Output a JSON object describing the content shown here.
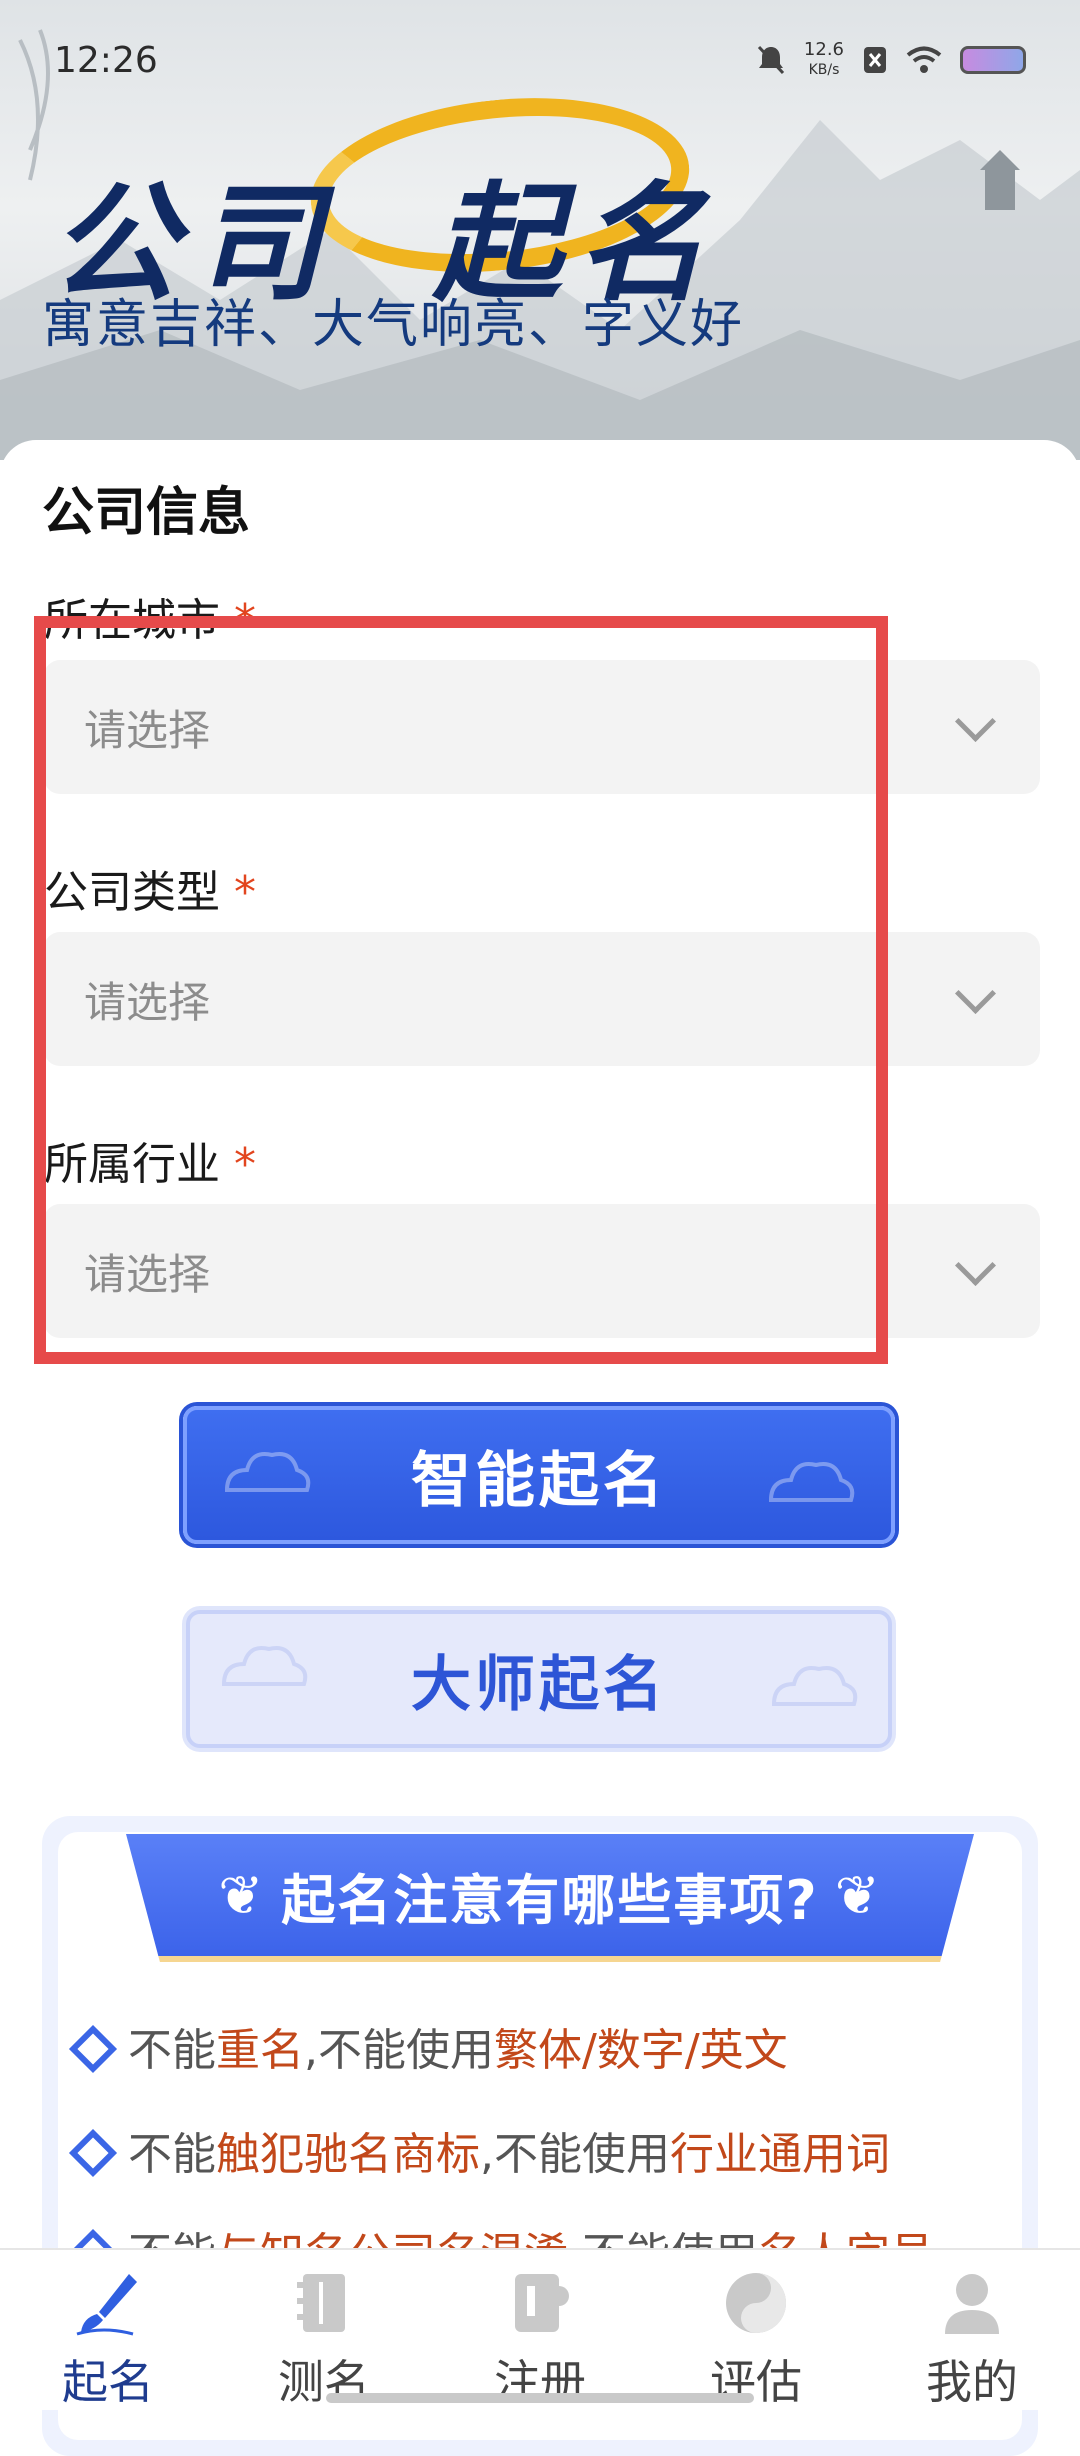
{
  "status_bar": {
    "time": "12:26",
    "net_speed_value": "12.6",
    "net_speed_unit": "KB/s"
  },
  "header": {
    "brand_left": "公司",
    "brand_right": "起名",
    "slogan": "寓意吉祥、大气响亮、字义好"
  },
  "form": {
    "section_title": "公司信息",
    "required_mark": "*",
    "fields": [
      {
        "label": "所在城市",
        "placeholder": "请选择"
      },
      {
        "label": "公司类型",
        "placeholder": "请选择"
      },
      {
        "label": "所属行业",
        "placeholder": "请选择"
      }
    ]
  },
  "buttons": {
    "smart": "智能起名",
    "master": "大师起名"
  },
  "notes": {
    "title": "起名注意有哪些事项?",
    "lines": [
      {
        "p1": "不能",
        "h1": "重名",
        "p2": ",不能使用",
        "h2": "繁体/数字/英文"
      },
      {
        "p1": "不能",
        "h1": "触犯驰名商标",
        "p2": ",不能使用",
        "h2": "行业通用词"
      },
      {
        "p1": "不能",
        "h1": "与知名公司名混淆",
        "p2": ",不能使用",
        "h2": "名人字号"
      }
    ]
  },
  "tabbar": {
    "tabs": [
      {
        "label": "起名",
        "icon": "brush-icon",
        "active": true
      },
      {
        "label": "测名",
        "icon": "notebook-icon",
        "active": false
      },
      {
        "label": "注册",
        "icon": "register-icon",
        "active": false
      },
      {
        "label": "评估",
        "icon": "yin-yang-icon",
        "active": false
      },
      {
        "label": "我的",
        "icon": "user-icon",
        "active": false
      }
    ]
  },
  "colors": {
    "accent_blue": "#2d58de",
    "required_red": "#e2451e",
    "highlight_orange": "#c2481a",
    "annotation_red": "#e64a4a"
  }
}
